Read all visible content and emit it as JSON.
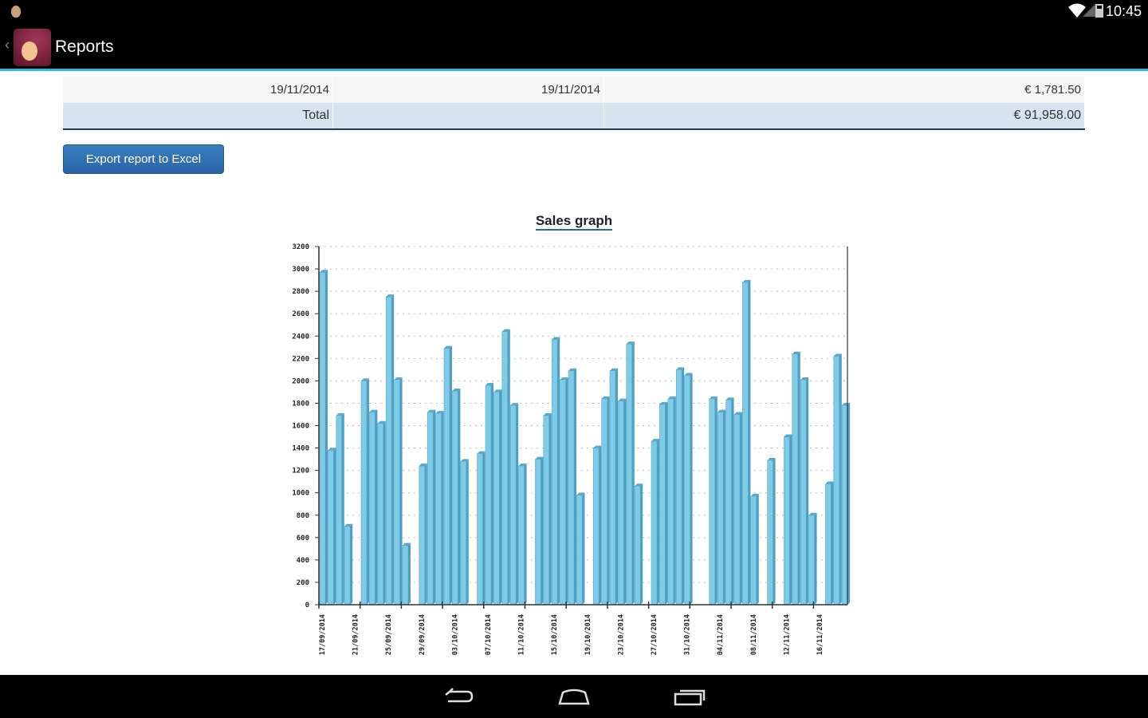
{
  "status_bar": {
    "time": "10:45"
  },
  "action_bar": {
    "title": "Reports"
  },
  "table": {
    "rows": [
      {
        "c1": "19/11/2014",
        "c2": "19/11/2014",
        "c3": "€ 1,781.50"
      }
    ],
    "total": {
      "label": "Total",
      "value": "€ 91,958.00"
    }
  },
  "export_button": "Export report to Excel",
  "chart_data": {
    "type": "bar",
    "title": "Sales graph",
    "ylim": [
      0,
      3200
    ],
    "yticks": [
      0,
      200,
      400,
      600,
      800,
      1000,
      1200,
      1400,
      1600,
      1800,
      2000,
      2200,
      2400,
      2600,
      2800,
      3000,
      3200
    ],
    "grid": true,
    "style": "3d",
    "bar_color": "#7ecbe8",
    "xtick_labels": [
      "17/09/2014",
      "21/09/2014",
      "25/09/2014",
      "29/09/2014",
      "03/10/2014",
      "07/10/2014",
      "11/10/2014",
      "15/10/2014",
      "19/10/2014",
      "23/10/2014",
      "27/10/2014",
      "31/10/2014",
      "04/11/2014",
      "08/11/2014",
      "12/11/2014",
      "16/11/2014"
    ],
    "categories": [
      "17/09/2014",
      "18/09/2014",
      "19/09/2014",
      "20/09/2014",
      "21/09/2014",
      "22/09/2014",
      "23/09/2014",
      "24/09/2014",
      "25/09/2014",
      "26/09/2014",
      "27/09/2014",
      "28/09/2014",
      "29/09/2014",
      "30/09/2014",
      "01/10/2014",
      "02/10/2014",
      "03/10/2014",
      "04/10/2014",
      "05/10/2014",
      "06/10/2014",
      "07/10/2014",
      "08/10/2014",
      "09/10/2014",
      "10/10/2014",
      "11/10/2014",
      "12/10/2014",
      "13/10/2014",
      "14/10/2014",
      "15/10/2014",
      "16/10/2014",
      "17/10/2014",
      "18/10/2014",
      "19/10/2014",
      "20/10/2014",
      "21/10/2014",
      "22/10/2014",
      "23/10/2014",
      "24/10/2014",
      "25/10/2014",
      "26/10/2014",
      "27/10/2014",
      "28/10/2014",
      "29/10/2014",
      "30/10/2014",
      "31/10/2014",
      "01/11/2014",
      "02/11/2014",
      "03/11/2014",
      "04/11/2014",
      "05/11/2014",
      "06/11/2014",
      "07/11/2014",
      "08/11/2014",
      "09/11/2014",
      "10/11/2014",
      "11/11/2014",
      "12/11/2014",
      "13/11/2014",
      "14/11/2014",
      "15/11/2014",
      "16/11/2014",
      "17/11/2014",
      "18/11/2014",
      "19/11/2014"
    ],
    "values": [
      2970,
      1380,
      1690,
      700,
      0,
      2000,
      1720,
      1620,
      2750,
      2010,
      530,
      0,
      1240,
      1720,
      1710,
      2290,
      1910,
      1280,
      0,
      1350,
      1960,
      1900,
      2440,
      1780,
      1240,
      0,
      1300,
      1690,
      2370,
      2010,
      2090,
      980,
      0,
      1400,
      1840,
      2090,
      1820,
      2330,
      1060,
      0,
      1460,
      1790,
      1840,
      2100,
      2050,
      0,
      0,
      1840,
      1720,
      1830,
      1700,
      2880,
      970,
      0,
      1290,
      0,
      1500,
      2240,
      2010,
      800,
      0,
      1080,
      2220,
      1781.5
    ]
  }
}
